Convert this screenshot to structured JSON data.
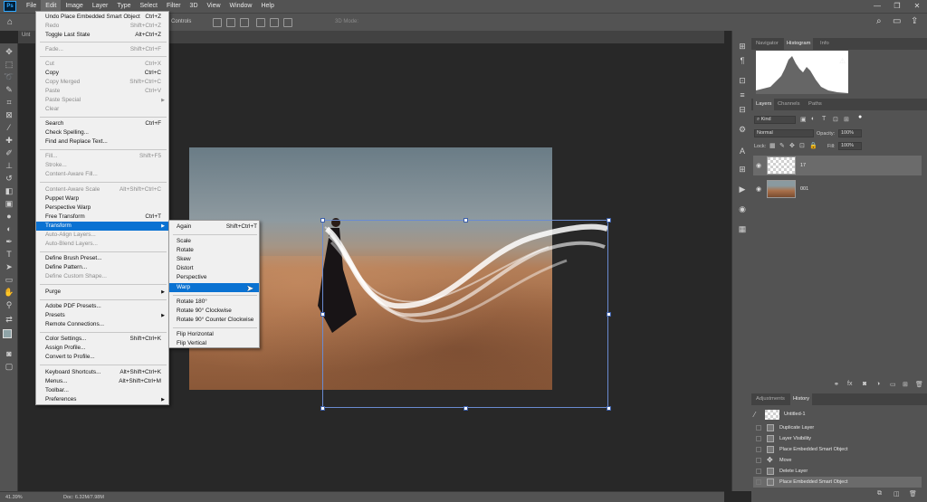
{
  "menubar": {
    "logo": "Ps",
    "items": [
      "File",
      "Edit",
      "Image",
      "Layer",
      "Type",
      "Select",
      "Filter",
      "3D",
      "View",
      "Window",
      "Help"
    ],
    "active": "Edit"
  },
  "optionsbar": {
    "controls_label": "Controls",
    "mode_label": "3D Mode:"
  },
  "document_tab": "Unt",
  "edit_menu": {
    "items": [
      {
        "label": "Undo Place Embedded Smart Object",
        "shortcut": "Ctrl+Z",
        "disabled": false
      },
      {
        "label": "Redo",
        "shortcut": "Shift+Ctrl+Z",
        "disabled": true
      },
      {
        "label": "Toggle Last State",
        "shortcut": "Alt+Ctrl+Z",
        "disabled": false
      },
      {
        "label": "Fade...",
        "shortcut": "Shift+Ctrl+F",
        "disabled": true
      },
      {
        "label": "Cut",
        "shortcut": "Ctrl+X",
        "disabled": true
      },
      {
        "label": "Copy",
        "shortcut": "Ctrl+C",
        "disabled": false
      },
      {
        "label": "Copy Merged",
        "shortcut": "Shift+Ctrl+C",
        "disabled": true
      },
      {
        "label": "Paste",
        "shortcut": "Ctrl+V",
        "disabled": true
      },
      {
        "label": "Paste Special",
        "shortcut": "",
        "disabled": true,
        "submenu": true
      },
      {
        "label": "Clear",
        "shortcut": "",
        "disabled": true
      },
      {
        "label": "Search",
        "shortcut": "Ctrl+F",
        "disabled": false
      },
      {
        "label": "Check Spelling...",
        "shortcut": "",
        "disabled": false
      },
      {
        "label": "Find and Replace Text...",
        "shortcut": "",
        "disabled": false
      },
      {
        "label": "Fill...",
        "shortcut": "Shift+F5",
        "disabled": true
      },
      {
        "label": "Stroke...",
        "shortcut": "",
        "disabled": true
      },
      {
        "label": "Content-Aware Fill...",
        "shortcut": "",
        "disabled": true
      },
      {
        "label": "Content-Aware Scale",
        "shortcut": "Alt+Shift+Ctrl+C",
        "disabled": true
      },
      {
        "label": "Puppet Warp",
        "shortcut": "",
        "disabled": false
      },
      {
        "label": "Perspective Warp",
        "shortcut": "",
        "disabled": false
      },
      {
        "label": "Free Transform",
        "shortcut": "Ctrl+T",
        "disabled": false
      },
      {
        "label": "Transform",
        "shortcut": "",
        "disabled": false,
        "submenu": true,
        "highlighted": true
      },
      {
        "label": "Auto-Align Layers...",
        "shortcut": "",
        "disabled": true
      },
      {
        "label": "Auto-Blend Layers...",
        "shortcut": "",
        "disabled": true
      },
      {
        "label": "Define Brush Preset...",
        "shortcut": "",
        "disabled": false
      },
      {
        "label": "Define Pattern...",
        "shortcut": "",
        "disabled": false
      },
      {
        "label": "Define Custom Shape...",
        "shortcut": "",
        "disabled": true
      },
      {
        "label": "Purge",
        "shortcut": "",
        "disabled": false,
        "submenu": true
      },
      {
        "label": "Adobe PDF Presets...",
        "shortcut": "",
        "disabled": false
      },
      {
        "label": "Presets",
        "shortcut": "",
        "disabled": false,
        "submenu": true
      },
      {
        "label": "Remote Connections...",
        "shortcut": "",
        "disabled": false
      },
      {
        "label": "Color Settings...",
        "shortcut": "Shift+Ctrl+K",
        "disabled": false
      },
      {
        "label": "Assign Profile...",
        "shortcut": "",
        "disabled": false
      },
      {
        "label": "Convert to Profile...",
        "shortcut": "",
        "disabled": false
      },
      {
        "label": "Keyboard Shortcuts...",
        "shortcut": "Alt+Shift+Ctrl+K",
        "disabled": false
      },
      {
        "label": "Menus...",
        "shortcut": "Alt+Shift+Ctrl+M",
        "disabled": false
      },
      {
        "label": "Toolbar...",
        "shortcut": "",
        "disabled": false
      },
      {
        "label": "Preferences",
        "shortcut": "",
        "disabled": false,
        "submenu": true
      }
    ]
  },
  "transform_menu": {
    "items": [
      {
        "label": "Again",
        "shortcut": "Shift+Ctrl+T"
      },
      {
        "label": "Scale",
        "shortcut": ""
      },
      {
        "label": "Rotate",
        "shortcut": ""
      },
      {
        "label": "Skew",
        "shortcut": ""
      },
      {
        "label": "Distort",
        "shortcut": ""
      },
      {
        "label": "Perspective",
        "shortcut": ""
      },
      {
        "label": "Warp",
        "shortcut": "",
        "highlighted": true
      },
      {
        "label": "Rotate 180°",
        "shortcut": ""
      },
      {
        "label": "Rotate 90° Clockwise",
        "shortcut": ""
      },
      {
        "label": "Rotate 90° Counter Clockwise",
        "shortcut": ""
      },
      {
        "label": "Flip Horizontal",
        "shortcut": ""
      },
      {
        "label": "Flip Vertical",
        "shortcut": ""
      }
    ]
  },
  "statusbar": {
    "zoom": "41.39%",
    "doc": "Doc: 6.32M/7.98M"
  },
  "panels": {
    "top_tabs": [
      "Navigator",
      "Histogram",
      "Info"
    ],
    "top_active": "Histogram",
    "layers_tabs": [
      "Layers",
      "Channels",
      "Paths"
    ],
    "layers_active": "Layers",
    "kind_label": "Kind",
    "blend_mode": "Normal",
    "opacity_label": "Opacity:",
    "opacity_value": "100%",
    "lock_label": "Lock:",
    "fill_label": "Fill:",
    "fill_value": "100%",
    "layers": [
      {
        "name": "17",
        "selected": true
      },
      {
        "name": "001",
        "selected": false
      }
    ],
    "bottom_tabs": [
      "Adjustments",
      "History"
    ],
    "bottom_active": "History",
    "history_snapshot": "Untitled-1",
    "history": [
      {
        "name": "Duplicate Layer",
        "selected": false
      },
      {
        "name": "Layer Visibility",
        "selected": false
      },
      {
        "name": "Place Embedded Smart Object",
        "selected": false
      },
      {
        "name": "Move",
        "selected": false
      },
      {
        "name": "Delete Layer",
        "selected": false
      },
      {
        "name": "Place Embedded Smart Object",
        "selected": true
      }
    ]
  },
  "colors": {
    "accent": "#0a72d2",
    "menu_bg": "#f0f0f0",
    "ui_dark": "#535353"
  }
}
